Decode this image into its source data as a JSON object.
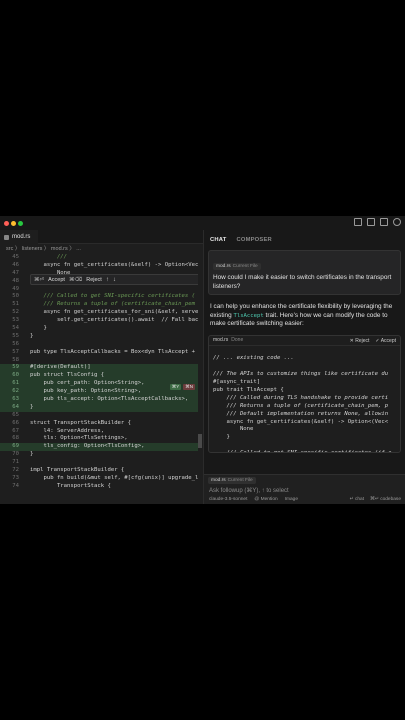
{
  "editor": {
    "tab_label": "mod.rs",
    "breadcrumbs": "src  〉 listeners 〉  mod.rs 〉 ...",
    "diff_bar": {
      "accept": "Accept",
      "accept_kbd": "⌘⏎",
      "reject": "Reject",
      "reject_kbd": "⌘⌫"
    },
    "hunk_accept": "⌘Y",
    "hunk_reject": "⌘N",
    "lines": [
      {
        "n": "45",
        "code": "        ///",
        "cls": "c",
        "added": false
      },
      {
        "n": "46",
        "code": "    async fn get_certificates(&self) -> Option<Vec>",
        "cls": "",
        "added": false
      },
      {
        "n": "47",
        "code": "        None",
        "cls": "",
        "added": false
      },
      {
        "n": "48",
        "code": "    }",
        "cls": "",
        "added": false
      },
      {
        "n": "49",
        "code": "",
        "cls": "",
        "added": false
      },
      {
        "n": "50",
        "code": "    /// Called to get SNI-specific certificates (",
        "cls": "c",
        "added": false
      },
      {
        "n": "51",
        "code": "    /// Returns a tuple of (certificate_chain_pem",
        "cls": "c",
        "added": false
      },
      {
        "n": "52",
        "code": "    async fn get_certificates_for_sni(&self, server",
        "cls": "",
        "added": false
      },
      {
        "n": "53",
        "code": "        self.get_certificates().await  // Fall back",
        "cls": "",
        "added": false
      },
      {
        "n": "54",
        "code": "    }",
        "cls": "",
        "added": false
      },
      {
        "n": "55",
        "code": "}",
        "cls": "",
        "added": false
      },
      {
        "n": "56",
        "code": "",
        "cls": "",
        "added": false
      },
      {
        "n": "57",
        "code": "pub type TlsAcceptCallbacks = Box<dyn TlsAccept + S",
        "cls": "",
        "added": false
      },
      {
        "n": "58",
        "code": "",
        "cls": "",
        "added": false
      },
      {
        "n": "59",
        "code": "#[derive(Default)]",
        "cls": "",
        "added": true
      },
      {
        "n": "60",
        "code": "pub struct TlsConfig {",
        "cls": "",
        "added": true
      },
      {
        "n": "61",
        "code": "    pub cert_path: Option<String>,",
        "cls": "",
        "added": true
      },
      {
        "n": "62",
        "code": "    pub key_path: Option<String>,",
        "cls": "",
        "added": true
      },
      {
        "n": "63",
        "code": "    pub tls_accept: Option<TlsAcceptCallbacks>,",
        "cls": "",
        "added": true
      },
      {
        "n": "64",
        "code": "}",
        "cls": "",
        "added": true
      },
      {
        "n": "65",
        "code": "",
        "cls": "",
        "added": false
      },
      {
        "n": "66",
        "code": "struct TransportStackBuilder {",
        "cls": "",
        "added": false
      },
      {
        "n": "67",
        "code": "    l4: ServerAddress,",
        "cls": "",
        "added": false
      },
      {
        "n": "68",
        "code": "    tls: Option<TlsSettings>,",
        "cls": "",
        "added": false
      },
      {
        "n": "69",
        "code": "    tls_config: Option<TlsConfig>,",
        "cls": "",
        "added": true
      },
      {
        "n": "70",
        "code": "}",
        "cls": "",
        "added": false
      },
      {
        "n": "71",
        "code": "",
        "cls": "",
        "added": false
      },
      {
        "n": "72",
        "code": "impl TransportStackBuilder {",
        "cls": "",
        "added": false
      },
      {
        "n": "73",
        "code": "    pub fn build(&mut self, #[cfg(unix)] upgrade_l",
        "cls": "",
        "added": false
      },
      {
        "n": "74",
        "code": "        TransportStack {",
        "cls": "",
        "added": false
      }
    ]
  },
  "chat": {
    "tabs": [
      {
        "label": "CHAT",
        "active": true
      },
      {
        "label": "COMPOSER",
        "active": false
      }
    ],
    "user_chip_file": "mod.rs",
    "user_chip_note": "Current File",
    "user_message": "How could I make it easier to switch certificates in the transport listeners?",
    "ai_text_1": "I can help you enhance the certificate flexibility by leveraging the existing",
    "ai_inline": "TlsAccept",
    "ai_text_2": "trait. Here's how we can modify the code to make certificate switching easier:",
    "codeblock": {
      "file": "mod.rs",
      "status": "Done",
      "reject": "✕ Reject",
      "accept": "✓ Accept",
      "lines": [
        {
          "code": " ",
          "cls": ""
        },
        {
          "code": "// ... existing code ...",
          "cls": "c"
        },
        {
          "code": " ",
          "cls": ""
        },
        {
          "code": "/// The APIs to customize things like certificate du",
          "cls": "c"
        },
        {
          "code": "#[async_trait]",
          "cls": ""
        },
        {
          "code": "pub trait TlsAccept {",
          "cls": ""
        },
        {
          "code": "    /// Called during TLS handshake to provide certi",
          "cls": "c"
        },
        {
          "code": "    /// Returns a tuple of (certificate_chain_pem, p",
          "cls": "c"
        },
        {
          "code": "    /// Default implementation returns None, allowin",
          "cls": "c"
        },
        {
          "code": "    async fn get_certificates(&self) -> Option<(Vec<",
          "cls": ""
        },
        {
          "code": "        None",
          "cls": ""
        },
        {
          "code": "    }",
          "cls": ""
        },
        {
          "code": " ",
          "cls": ""
        },
        {
          "code": "    /// Called to get SNI-specific certificates (if a",
          "cls": "c"
        }
      ]
    },
    "input": {
      "chip_file": "mod.rs",
      "chip_note": "Current File",
      "placeholder": "Ask followup (⌘Y), ↑ to select",
      "model": "claude-3.5-sonnet",
      "mention": "@ Mention",
      "image": "Image",
      "chat_btn": "↵ chat",
      "codebase_btn": "⌘↵ codebase"
    }
  }
}
